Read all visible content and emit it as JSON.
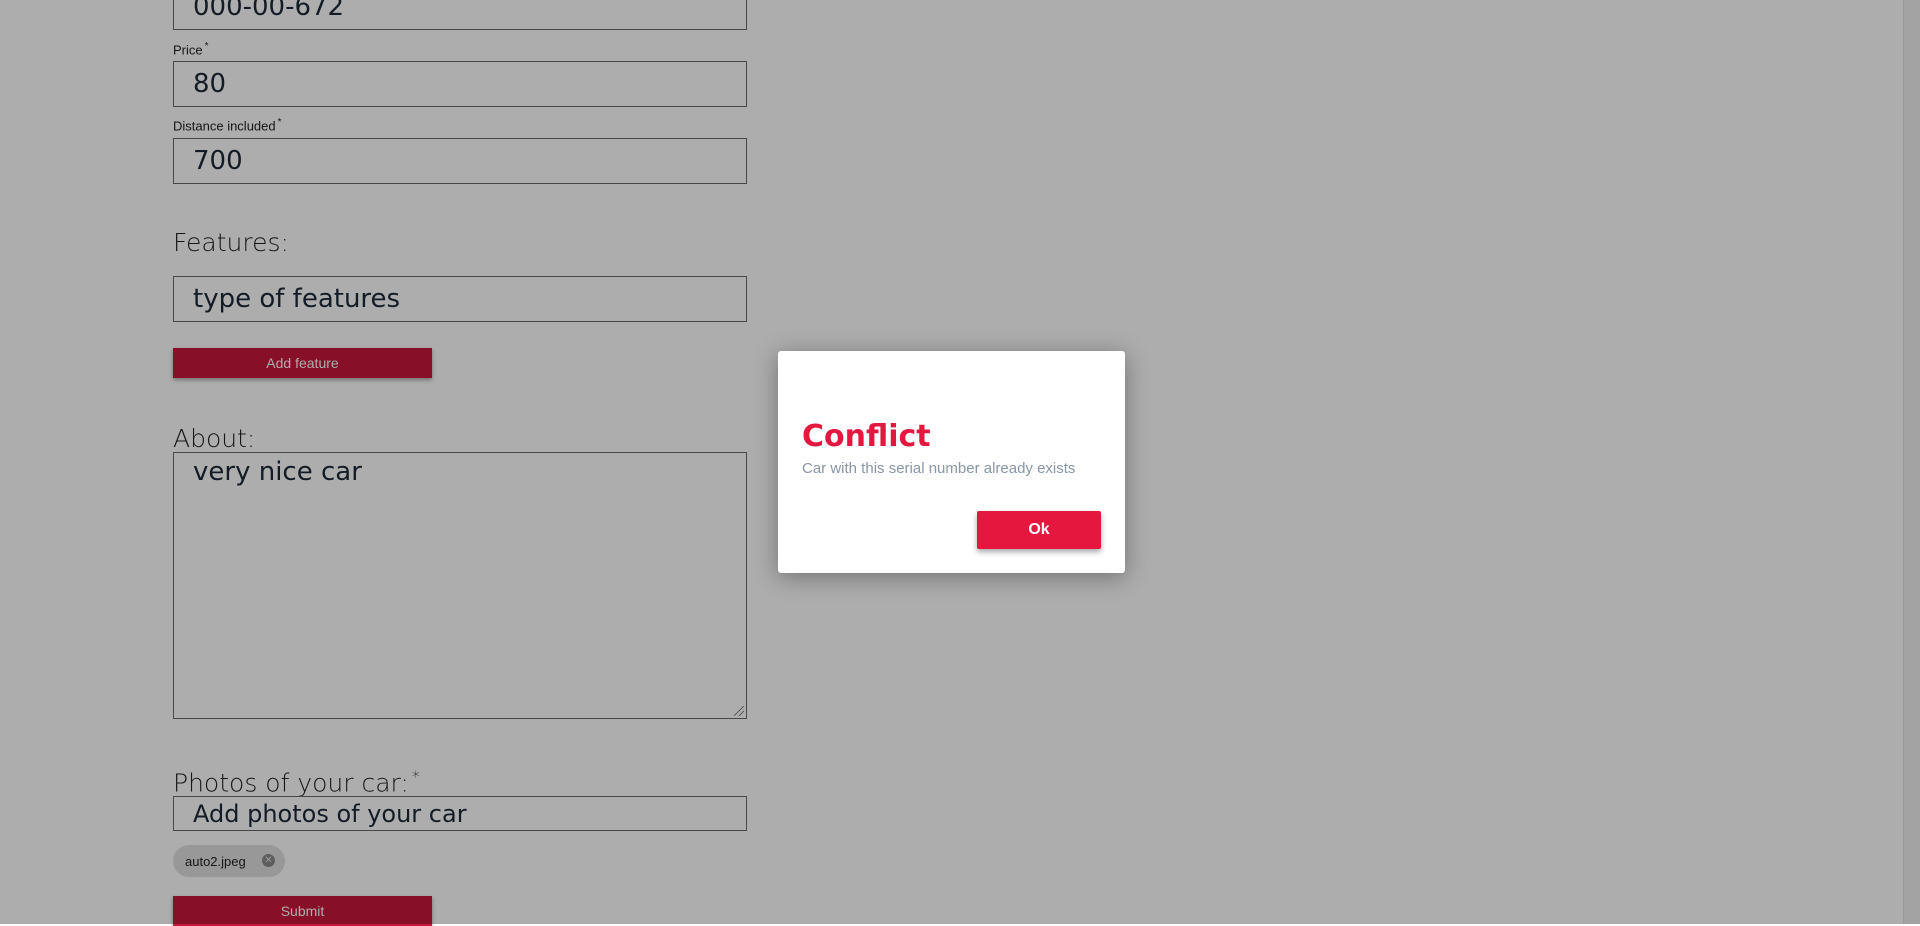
{
  "form": {
    "serial_value": "000-00-672",
    "price_label": "Price",
    "price_required_mark": "*",
    "price_value": "80",
    "distance_label": "Distance included",
    "distance_required_mark": "*",
    "distance_value": "700",
    "features_label": "Features:",
    "features_placeholder": "type of features",
    "add_feature_label": "Add feature",
    "about_label": "About:",
    "about_value": "very nice car",
    "photos_label": "Photos of your car:",
    "photos_required_mark": "*",
    "photos_placeholder": "Add photos of your car",
    "photo_chip_label": "auto2.jpeg",
    "submit_label": "Submit"
  },
  "modal": {
    "title": "Conflict",
    "message": "Car with this serial number already exists",
    "ok_label": "Ok"
  },
  "colors": {
    "accent": "#e5173f",
    "button_red": "#c8173a",
    "overlay": "rgba(0,0,0,0.32)"
  },
  "icons": {
    "chip_remove": "close-circle-icon"
  }
}
